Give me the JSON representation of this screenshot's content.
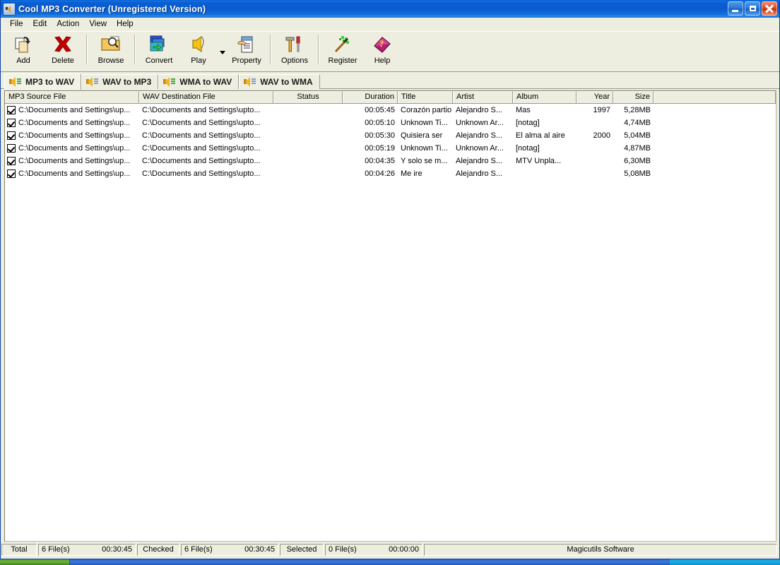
{
  "window": {
    "title": "Cool MP3 Converter (Unregistered Version)",
    "icon": "speaker-icon",
    "buttons": {
      "minimize": "minimize-button",
      "maximize": "maximize-button",
      "close": "close-button"
    }
  },
  "menu": {
    "items": [
      {
        "label": "File"
      },
      {
        "label": "Edit"
      },
      {
        "label": "Action"
      },
      {
        "label": "View"
      },
      {
        "label": "Help"
      }
    ]
  },
  "toolbar": {
    "buttons": [
      {
        "label": "Add",
        "icon": "add-file-icon"
      },
      {
        "label": "Delete",
        "icon": "red-x-icon"
      },
      {
        "label": "Browse",
        "icon": "folder-magnifier-icon"
      },
      {
        "label": "Convert",
        "icon": "convert-arrow-icon"
      },
      {
        "label": "Play",
        "icon": "speaker-play-icon"
      },
      {
        "label": "Property",
        "icon": "clipboard-icon"
      },
      {
        "label": "Options",
        "icon": "hammer-screwdriver-icon"
      },
      {
        "label": "Register",
        "icon": "magic-wand-icon"
      },
      {
        "label": "Help",
        "icon": "help-book-icon"
      }
    ]
  },
  "tabs": [
    {
      "label": "MP3 to WAV",
      "active": true
    },
    {
      "label": "WAV to MP3",
      "active": false
    },
    {
      "label": "WMA to WAV",
      "active": false
    },
    {
      "label": "WAV to WMA",
      "active": false
    }
  ],
  "list": {
    "columns": [
      {
        "label": "MP3 Source File",
        "align": "left"
      },
      {
        "label": "WAV Destination File",
        "align": "left"
      },
      {
        "label": "Status",
        "align": "center"
      },
      {
        "label": "Duration",
        "align": "right"
      },
      {
        "label": "Title",
        "align": "left"
      },
      {
        "label": "Artist",
        "align": "left"
      },
      {
        "label": "Album",
        "align": "left"
      },
      {
        "label": "Year",
        "align": "right"
      },
      {
        "label": "Size",
        "align": "right"
      },
      {
        "label": "",
        "align": "left"
      }
    ],
    "rows": [
      {
        "checked": true,
        "source": "C:\\Documents and Settings\\up...",
        "destination": "C:\\Documents and Settings\\upto...",
        "status": "",
        "duration": "00:05:45",
        "title": "Corazón partio",
        "artist": "Alejandro S...",
        "album": "Mas",
        "year": "1997",
        "size": "5,28MB"
      },
      {
        "checked": true,
        "source": "C:\\Documents and Settings\\up...",
        "destination": "C:\\Documents and Settings\\upto...",
        "status": "",
        "duration": "00:05:10",
        "title": "Unknown Ti...",
        "artist": "Unknown Ar...",
        "album": "[notag]",
        "year": "",
        "size": "4,74MB"
      },
      {
        "checked": true,
        "source": "C:\\Documents and Settings\\up...",
        "destination": "C:\\Documents and Settings\\upto...",
        "status": "",
        "duration": "00:05:30",
        "title": "Quisiera ser",
        "artist": "Alejandro S...",
        "album": "El alma al aire",
        "year": "2000",
        "size": "5,04MB"
      },
      {
        "checked": true,
        "source": "C:\\Documents and Settings\\up...",
        "destination": "C:\\Documents and Settings\\upto...",
        "status": "",
        "duration": "00:05:19",
        "title": "Unknown Ti...",
        "artist": "Unknown Ar...",
        "album": "[notag]",
        "year": "",
        "size": "4,87MB"
      },
      {
        "checked": true,
        "source": "C:\\Documents and Settings\\up...",
        "destination": "C:\\Documents and Settings\\upto...",
        "status": "",
        "duration": "00:04:35",
        "title": "Y solo se m...",
        "artist": "Alejandro S...",
        "album": "MTV Unpla...",
        "year": "",
        "size": "6,30MB"
      },
      {
        "checked": true,
        "source": "C:\\Documents and Settings\\up...",
        "destination": "C:\\Documents and Settings\\upto...",
        "status": "",
        "duration": "00:04:26",
        "title": "Me ire",
        "artist": "Alejandro S...",
        "album": "",
        "year": "",
        "size": "5,08MB"
      }
    ]
  },
  "status_bar": {
    "total_label": "Total",
    "total_files": "6 File(s)",
    "total_time": "00:30:45",
    "checked_label": "Checked",
    "checked_files": "6 File(s)",
    "checked_time": "00:30:45",
    "selected_label": "Selected",
    "selected_files": "0 File(s)",
    "selected_time": "00:00:00",
    "vendor": "Magicutils Software"
  },
  "colors": {
    "title_bar": "#0a5ad0",
    "window_face": "#eeeee0",
    "list_background": "#ffffff",
    "accent_orange": "#f0b323",
    "taskbar_blue": "#2a66c8",
    "start_green": "#4d9a2a"
  }
}
